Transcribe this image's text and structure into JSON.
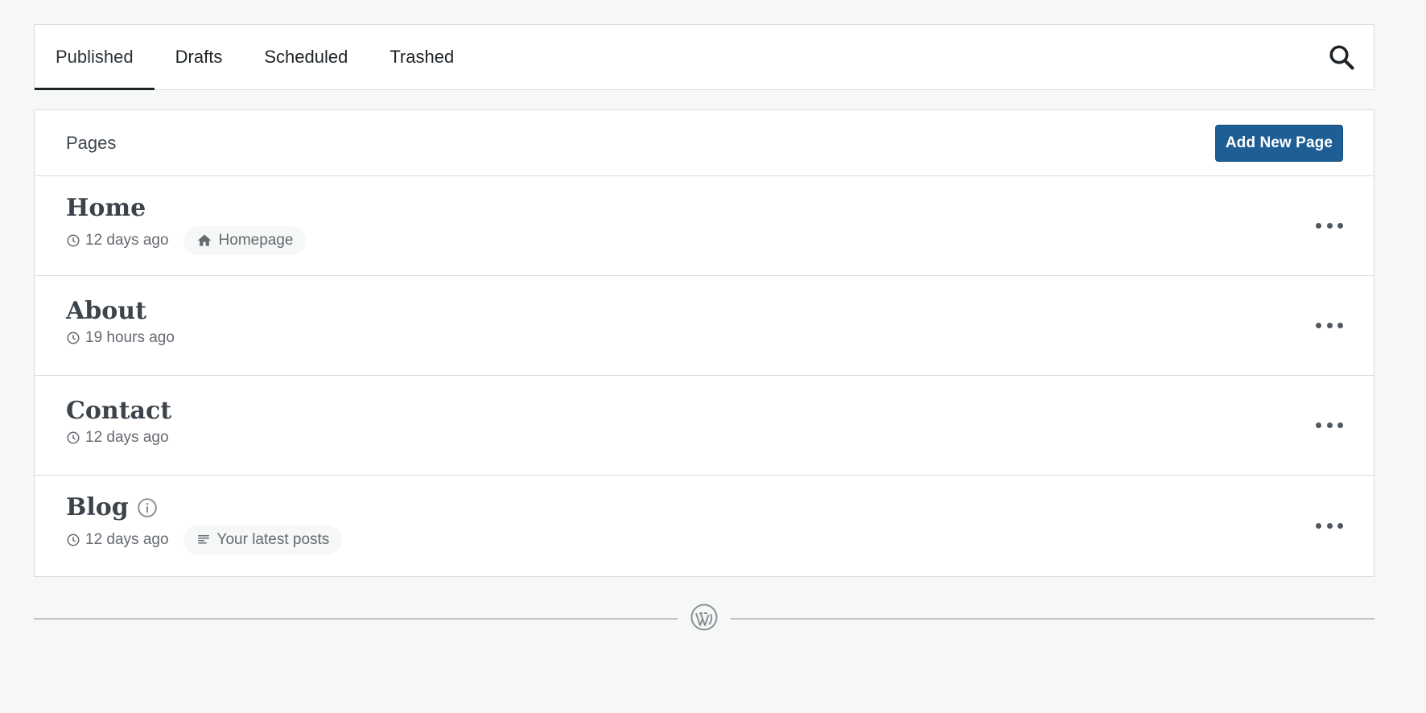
{
  "tabs": [
    {
      "label": "Published",
      "active": true
    },
    {
      "label": "Drafts",
      "active": false
    },
    {
      "label": "Scheduled",
      "active": false
    },
    {
      "label": "Trashed",
      "active": false
    }
  ],
  "search_icon": "search-icon",
  "header": {
    "title": "Pages",
    "add_button": "Add New Page"
  },
  "pages": [
    {
      "title": "Home",
      "time": "12 days ago",
      "badge": "Homepage",
      "badge_icon": "home-icon"
    },
    {
      "title": "About",
      "time": "19 hours ago"
    },
    {
      "title": "Contact",
      "time": "12 days ago"
    },
    {
      "title": "Blog",
      "time": "12 days ago",
      "badge": "Your latest posts",
      "badge_icon": "posts-icon",
      "info_icon": "info-icon"
    }
  ],
  "colors": {
    "accent": "#1e5e94",
    "background": "#f6f7f7"
  },
  "footer_icon": "wordpress-logo-icon"
}
